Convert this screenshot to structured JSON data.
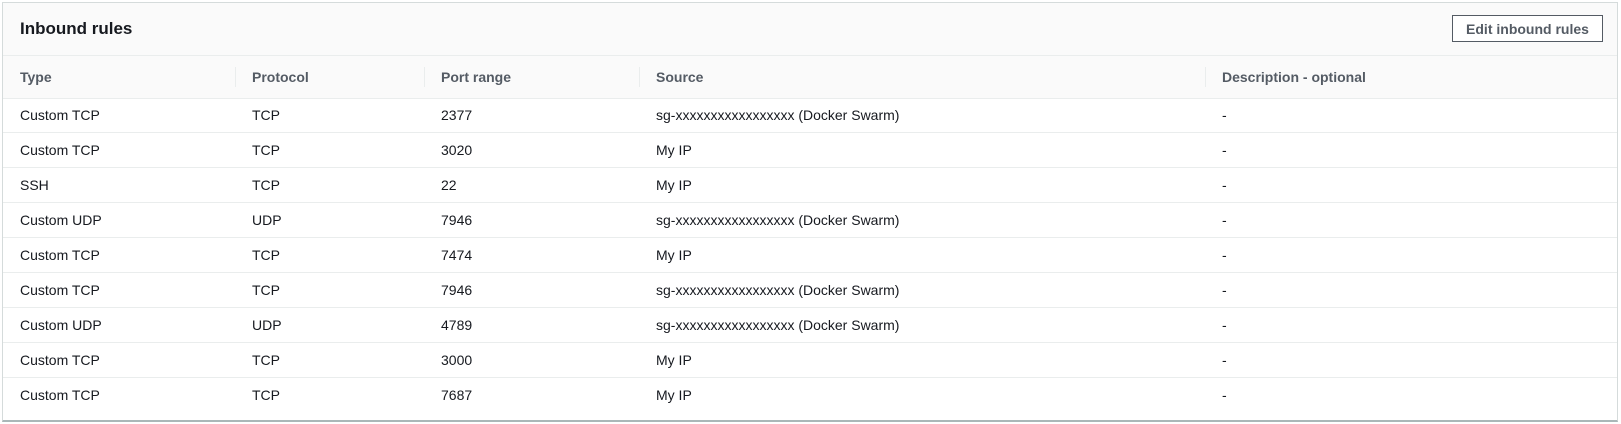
{
  "panel": {
    "title": "Inbound rules",
    "edit_button_label": "Edit inbound rules"
  },
  "table": {
    "columns": [
      "Type",
      "Protocol",
      "Port range",
      "Source",
      "Description - optional"
    ],
    "rows": [
      {
        "type": "Custom TCP",
        "protocol": "TCP",
        "port_range": "2377",
        "source": "sg-xxxxxxxxxxxxxxxxx (Docker Swarm)",
        "description": "-"
      },
      {
        "type": "Custom TCP",
        "protocol": "TCP",
        "port_range": "3020",
        "source": "My IP",
        "description": "-"
      },
      {
        "type": "SSH",
        "protocol": "TCP",
        "port_range": "22",
        "source": "My IP",
        "description": "-"
      },
      {
        "type": "Custom UDP",
        "protocol": "UDP",
        "port_range": "7946",
        "source": "sg-xxxxxxxxxxxxxxxxx (Docker Swarm)",
        "description": "-"
      },
      {
        "type": "Custom TCP",
        "protocol": "TCP",
        "port_range": "7474",
        "source": "My IP",
        "description": "-"
      },
      {
        "type": "Custom TCP",
        "protocol": "TCP",
        "port_range": "7946",
        "source": "sg-xxxxxxxxxxxxxxxxx (Docker Swarm)",
        "description": "-"
      },
      {
        "type": "Custom UDP",
        "protocol": "UDP",
        "port_range": "4789",
        "source": "sg-xxxxxxxxxxxxxxxxx (Docker Swarm)",
        "description": "-"
      },
      {
        "type": "Custom TCP",
        "protocol": "TCP",
        "port_range": "3000",
        "source": "My IP",
        "description": "-"
      },
      {
        "type": "Custom TCP",
        "protocol": "TCP",
        "port_range": "7687",
        "source": "My IP",
        "description": "-"
      }
    ]
  }
}
